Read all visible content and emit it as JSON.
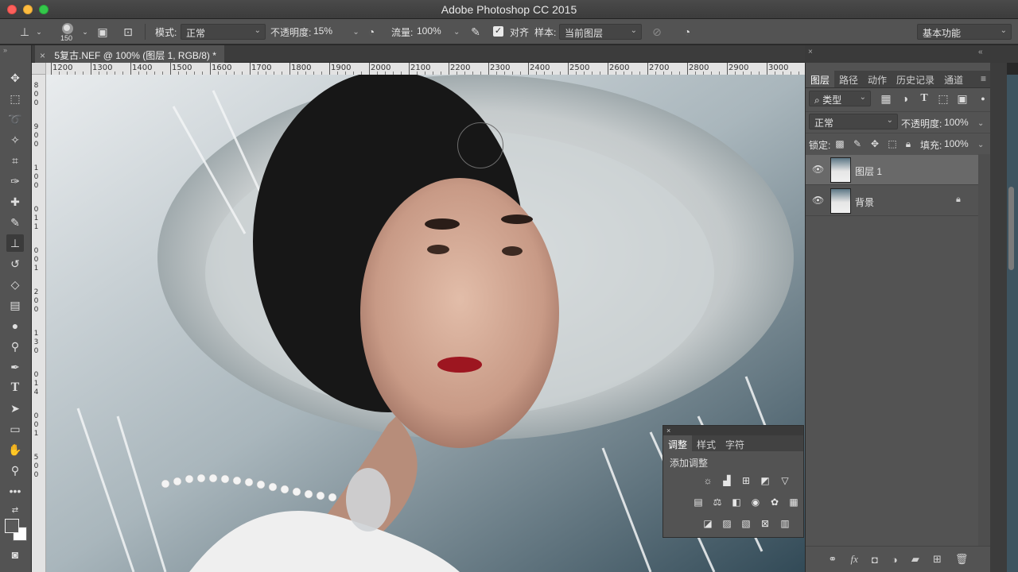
{
  "app_title": "Adobe Photoshop CC 2015",
  "options_bar": {
    "brush_size": "150",
    "mode_label": "模式:",
    "mode_value": "正常",
    "opacity_label": "不透明度:",
    "opacity_value": "15%",
    "flow_label": "流量:",
    "flow_value": "100%",
    "align_label": "对齐",
    "sample_label": "样本:",
    "sample_value": "当前图层",
    "workspace_value": "基本功能"
  },
  "document_tab": {
    "close": "×",
    "title": "5复古.NEF @ 100% (图层 1, RGB/8) *"
  },
  "ruler": {
    "top_labels": [
      "1200",
      "1300",
      "1400",
      "1500",
      "1600",
      "1700",
      "1800",
      "1900",
      "2000",
      "2100",
      "2200",
      "2300",
      "2400",
      "2500",
      "2600",
      "2700",
      "2800",
      "2900",
      "3000"
    ],
    "left_labels": [
      "8",
      "0",
      "0",
      "9",
      "0",
      "0",
      "1",
      "0",
      "0",
      "0",
      "1",
      "1",
      "0",
      "0",
      "1",
      "2",
      "0",
      "0",
      "1",
      "3",
      "0",
      "0",
      "1",
      "4",
      "0",
      "0",
      "1",
      "5",
      "0",
      "0"
    ]
  },
  "layers_panel": {
    "tabs": [
      "图层",
      "路径",
      "动作",
      "历史记录",
      "通道"
    ],
    "active_tab": 0,
    "filter_label": "类型",
    "blend_mode": "正常",
    "opacity_label": "不透明度:",
    "opacity_value": "100%",
    "lock_label": "锁定:",
    "fill_label": "填充:",
    "fill_value": "100%",
    "layers": [
      {
        "name": "图层 1",
        "selected": true,
        "locked": false
      },
      {
        "name": "背景",
        "selected": false,
        "locked": true
      }
    ]
  },
  "adjustments_panel": {
    "tabs": [
      "调整",
      "样式",
      "字符"
    ],
    "active_tab": 0,
    "title": "添加调整"
  }
}
